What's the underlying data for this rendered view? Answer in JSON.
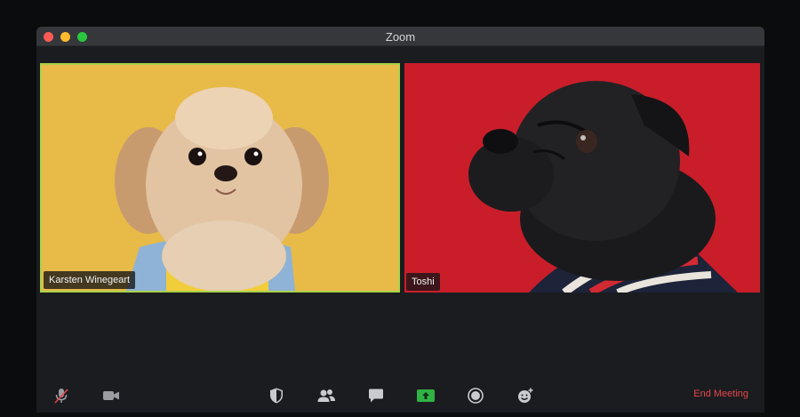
{
  "window": {
    "title": "Zoom"
  },
  "participants": [
    {
      "name": "Karsten Winegeart",
      "active_speaker": true
    },
    {
      "name": "Toshi",
      "active_speaker": false
    }
  ],
  "toolbar": {
    "buttons": [
      {
        "icon": "microphone-muted-icon"
      },
      {
        "icon": "video-camera-icon"
      },
      {
        "icon": "security-shield-icon"
      },
      {
        "icon": "participants-icon"
      },
      {
        "icon": "chat-icon"
      },
      {
        "icon": "share-screen-icon"
      },
      {
        "icon": "record-icon"
      },
      {
        "icon": "reactions-icon"
      }
    ],
    "end_label": "End Meeting"
  },
  "colors": {
    "accent_green": "#2fb344",
    "speaker_border": "#a9d24a",
    "end_meeting": "#e5484d"
  }
}
